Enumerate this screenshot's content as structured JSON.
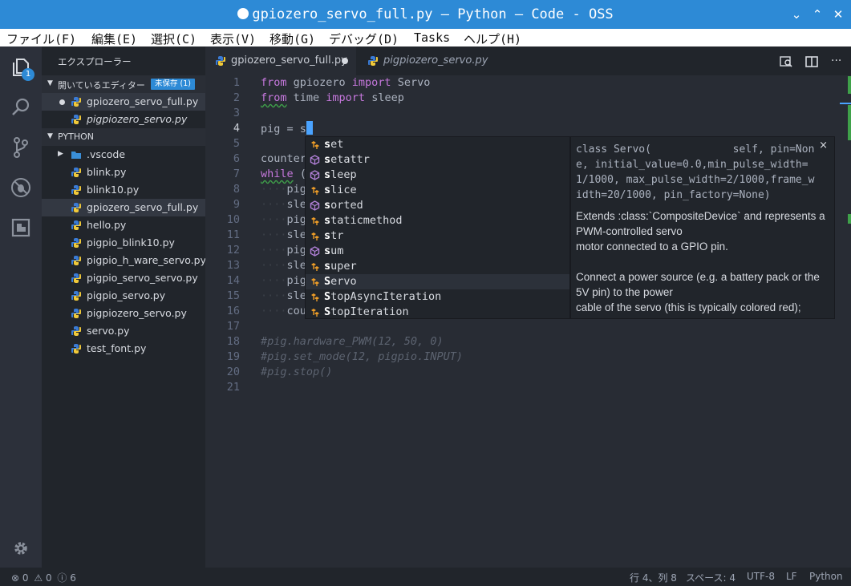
{
  "window": {
    "title": "gpiozero_servo_full.py — Python — Code - OSS",
    "minimize": "⌄",
    "maximize": "⌃",
    "close": "✕"
  },
  "menu": [
    "ファイル(F)",
    "編集(E)",
    "選択(C)",
    "表示(V)",
    "移動(G)",
    "デバッグ(D)",
    "Tasks",
    "ヘルプ(H)"
  ],
  "activity": {
    "explorer_badge": "1",
    "icons": [
      "files-icon",
      "search-icon",
      "source-control-icon",
      "debug-icon",
      "extensions-icon",
      "gear-icon"
    ]
  },
  "sidebar": {
    "title": "エクスプローラー",
    "open_editors": {
      "label": "開いているエディター",
      "unsaved_badge": "未保存 (1)",
      "items": [
        {
          "name": "gpiozero_servo_full.py",
          "modified": true,
          "italic": false
        },
        {
          "name": "pigpiozero_servo.py",
          "modified": false,
          "italic": true
        }
      ]
    },
    "folder": {
      "label": "PYTHON",
      "vscode": ".vscode",
      "files": [
        "blink.py",
        "blink10.py",
        "gpiozero_servo_full.py",
        "hello.py",
        "pigpio_blink10.py",
        "pigpio_h_ware_servo.py",
        "pigpio_servo_servo.py",
        "pigpio_servo.py",
        "pigpiozero_servo.py",
        "servo.py",
        "test_font.py"
      ],
      "selected_index": 2
    }
  },
  "tabs": [
    {
      "name": "gpiozero_servo_full.py",
      "active": true,
      "modified": true
    },
    {
      "name": "pigpiozero_servo.py",
      "active": false,
      "modified": false
    }
  ],
  "editor": {
    "line_numbers": [
      "1",
      "2",
      "3",
      "4",
      "5",
      "6",
      "7",
      "8",
      "9",
      "10",
      "11",
      "12",
      "13",
      "14",
      "15",
      "16",
      "17",
      "18",
      "19",
      "20",
      "21"
    ],
    "l1_kw1": "from",
    "l1_mod": " gpiozero ",
    "l1_kw2": "import",
    "l1_name": " Servo",
    "l2_kw1": "from",
    "l2_mod": " time ",
    "l2_kw2": "import",
    "l2_name": " sleep",
    "l4_text": "pig = s",
    "l6_text": "counter",
    "l7_kw": "while",
    "l7_rest": " (",
    "l8": "pig",
    "l9": "sle",
    "l10": "pig",
    "l11": "sle",
    "l12": "pig",
    "l13": "sle",
    "l14": "pig",
    "l15": "sle",
    "l16": "cou",
    "l18": "#pig.hardware_PWM(12, 50, 0)",
    "l19": "#pig.set_mode(12, pigpio.INPUT)",
    "l20": "#pig.stop()"
  },
  "suggest": {
    "prefix": "s",
    "items": [
      {
        "head": "s",
        "tail": "et",
        "kind": "class"
      },
      {
        "head": "s",
        "tail": "etattr",
        "kind": "function"
      },
      {
        "head": "s",
        "tail": "leep",
        "kind": "function"
      },
      {
        "head": "s",
        "tail": "lice",
        "kind": "class"
      },
      {
        "head": "s",
        "tail": "orted",
        "kind": "function"
      },
      {
        "head": "s",
        "tail": "taticmethod",
        "kind": "class"
      },
      {
        "head": "s",
        "tail": "tr",
        "kind": "class"
      },
      {
        "head": "s",
        "tail": "um",
        "kind": "function"
      },
      {
        "head": "s",
        "tail": "uper",
        "kind": "class"
      },
      {
        "head": "S",
        "tail": "ervo",
        "kind": "class"
      },
      {
        "head": "S",
        "tail": "topAsyncIteration",
        "kind": "class"
      },
      {
        "head": "S",
        "tail": "topIteration",
        "kind": "class"
      }
    ],
    "focused_index": 9
  },
  "details": {
    "signature": "class Servo(             self, pin=None, initial_value=0.0,min_pulse_width=1/1000, max_pulse_width=2/1000,frame_width=20/1000, pin_factory=None)",
    "doc_line1": "Extends :class:`CompositeDevice` and represents a PWM-controlled servo",
    "doc_line2": "motor connected to a GPIO pin.",
    "doc_line3": "Connect a power source (e.g. a battery pack or the 5V pin) to the power",
    "doc_line4": "cable of the servo (this is typically colored red);",
    "close": "×"
  },
  "status": {
    "errors": "0",
    "warnings": "0",
    "info": "6",
    "position": "行 4、列 8",
    "spaces": "スペース: 4",
    "encoding": "UTF-8",
    "eol": "LF",
    "language": "Python"
  },
  "colors": {
    "titlebar": "#2d8ad6",
    "keyword": "#c678dd",
    "comment": "#5c6370",
    "cursor": "#4aa3ff"
  }
}
